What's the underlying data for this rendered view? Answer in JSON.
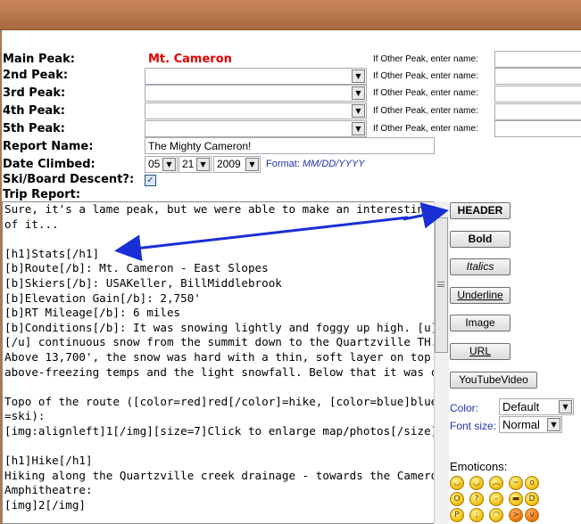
{
  "labels": {
    "main_peak": "Main Peak:",
    "peak2": "2nd Peak:",
    "peak3": "3rd Peak:",
    "peak4": "4th Peak:",
    "peak5": "5th Peak:",
    "report_name": "Report Name:",
    "date_climbed": "Date Climbed:",
    "ski_descent": "Ski/Board Descent?:",
    "trip_report": "Trip Report:"
  },
  "main_peak_value": "Mt. Cameron",
  "other_peak_label": "If Other Peak, enter name:",
  "report_name_value": "The Mighty Cameron!",
  "date": {
    "month": "05",
    "day": "21",
    "year": "2009",
    "format_label": "Format: ",
    "format_value": "MM/DD/YYYY"
  },
  "ski_checked": true,
  "editor_text": "Sure, it's a lame peak, but we were able to make an interesting ski out\nof it...\n\n[h1]Stats[/h1]\n[b]Route[/b]: Mt. Cameron - East Slopes\n[b]Skiers[/b]: USAKeller, BillMiddlebrook\n[b]Elevation Gain[/b]: 2,750'\n[b]RT Mileage[/b]: 6 miles\n[b]Conditions[/b]: It was snowing lightly and foggy up high. [u]Almost\n[/u] continuous snow from the summit down to the Quartzville TH.\nAbove 13,700', the snow was hard with a thin, soft layer on top from\nabove-freezing temps and the light snowfall. Below that it was corn.\n\nTopo of the route ([color=red]red[/color]=hike, [color=blue]blue[/color]\n=ski):\n[img:alignleft]1[/img][size=7]Click to enlarge map/photos[/size]\n\n[h1]Hike[/h1]\nHiking along the Quartzville creek drainage - towards the Cameron\nAmphitheatre:\n[img]2[/img]",
  "toolbar": {
    "header": "HEADER",
    "bold": "Bold",
    "italics": "Italics",
    "underline": "Underline",
    "image": "Image",
    "url": "URL",
    "youtube": "YouTubeVideo"
  },
  "color": {
    "label": "Color:",
    "value": "Default"
  },
  "font_size": {
    "label": "Font size:",
    "value": "Normal"
  },
  "emoticons_label": "Emoticons:",
  "annotation_color": "#1a2fd6"
}
